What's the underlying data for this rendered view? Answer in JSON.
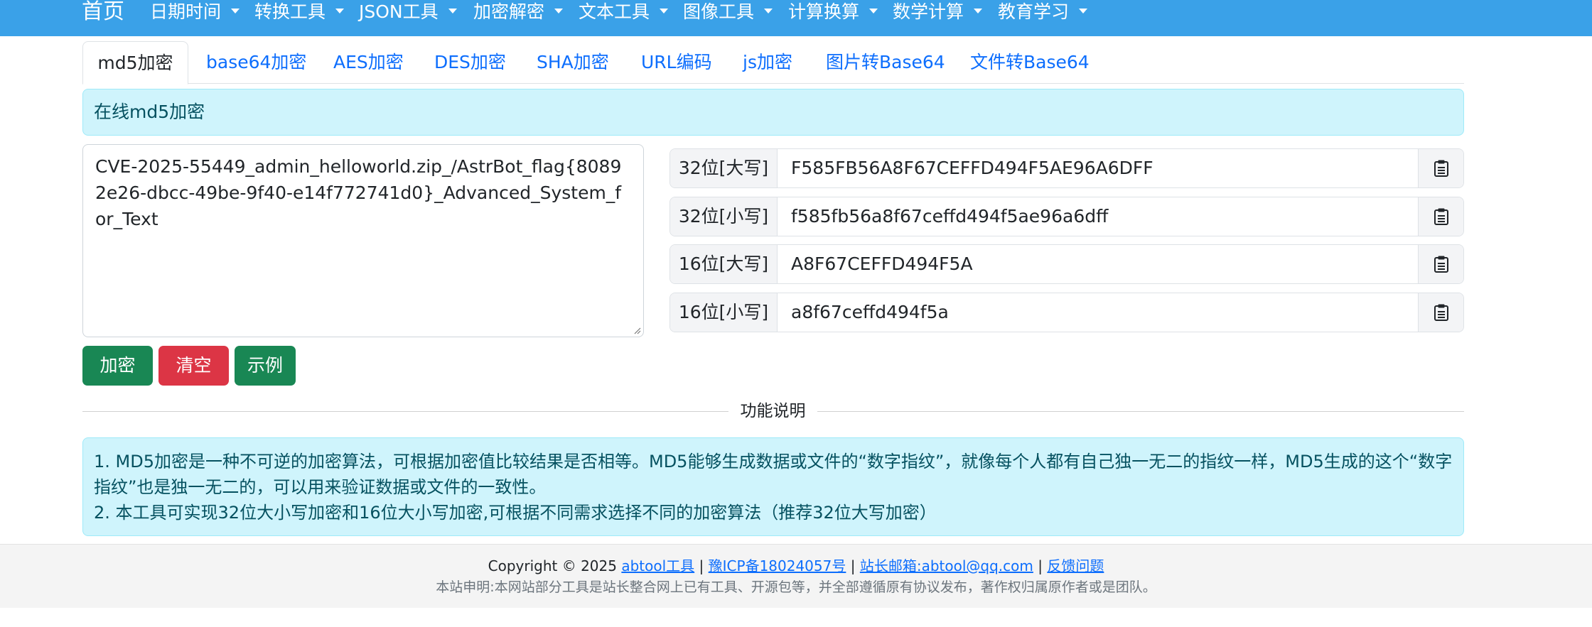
{
  "navbar": {
    "brand": "首页",
    "items": [
      {
        "label": "日期时间"
      },
      {
        "label": "转换工具"
      },
      {
        "label": "JSON工具"
      },
      {
        "label": "加密解密"
      },
      {
        "label": "文本工具"
      },
      {
        "label": "图像工具"
      },
      {
        "label": "计算换算"
      },
      {
        "label": "数学计算"
      },
      {
        "label": "教育学习"
      }
    ]
  },
  "tabs": [
    {
      "label": "md5加密",
      "active": true
    },
    {
      "label": "base64加密"
    },
    {
      "label": "AES加密"
    },
    {
      "label": "DES加密"
    },
    {
      "label": "SHA加密"
    },
    {
      "label": "URL编码"
    },
    {
      "label": "js加密"
    },
    {
      "label": "图片转Base64"
    },
    {
      "label": "文件转Base64"
    }
  ],
  "title_alert": "在线md5加密",
  "input": {
    "value": "CVE-2025-55449_admin_helloworld.zip_/AstrBot_flag{80892e26-dbcc-49be-9f40-e14f772741d0}_Advanced_System_for_Text"
  },
  "results": [
    {
      "label": "32位[大写]",
      "value": "F585FB56A8F67CEFFD494F5AE96A6DFF"
    },
    {
      "label": "32位[小写]",
      "value": "f585fb56a8f67ceffd494f5ae96a6dff"
    },
    {
      "label": "16位[大写]",
      "value": "A8F67CEFFD494F5A"
    },
    {
      "label": "16位[小写]",
      "value": "a8f67ceffd494f5a"
    }
  ],
  "buttons": {
    "encrypt": "加密",
    "clear": "清空",
    "example": "示例"
  },
  "divider_label": "功能说明",
  "description": {
    "line1": "1. MD5加密是一种不可逆的加密算法，可根据加密值比较结果是否相等。MD5能够生成数据或文件的“数字指纹”，就像每个人都有自己独一无二的指纹一样，MD5生成的这个“数字指纹”也是独一无二的，可以用来验证数据或文件的一致性。",
    "line2": "2. 本工具可实现32位大小写加密和16位大小写加密,可根据不同需求选择不同的加密算法（推荐32位大写加密）"
  },
  "footer": {
    "copyright": "Copyright © 2025",
    "link_site": "abtool工具",
    "sep": "|",
    "link_icp": "豫ICP备18024057号",
    "link_email": "站长邮箱:abtool@qq.com",
    "link_feedback": "反馈问题",
    "statement": "本站申明:本网站部分工具是站长整合网上已有工具、开源包等，并全部遵循原有协议发布，著作权归属原作者或是团队。"
  },
  "colors": {
    "navbar": "#3aa1e8",
    "link": "#0d6efd",
    "info_bg": "#cff4fc",
    "info_text": "#055160",
    "success": "#198754",
    "danger": "#dc3545"
  },
  "icons": {
    "copy": "clipboard-icon",
    "dropdown": "caret-down-icon"
  }
}
